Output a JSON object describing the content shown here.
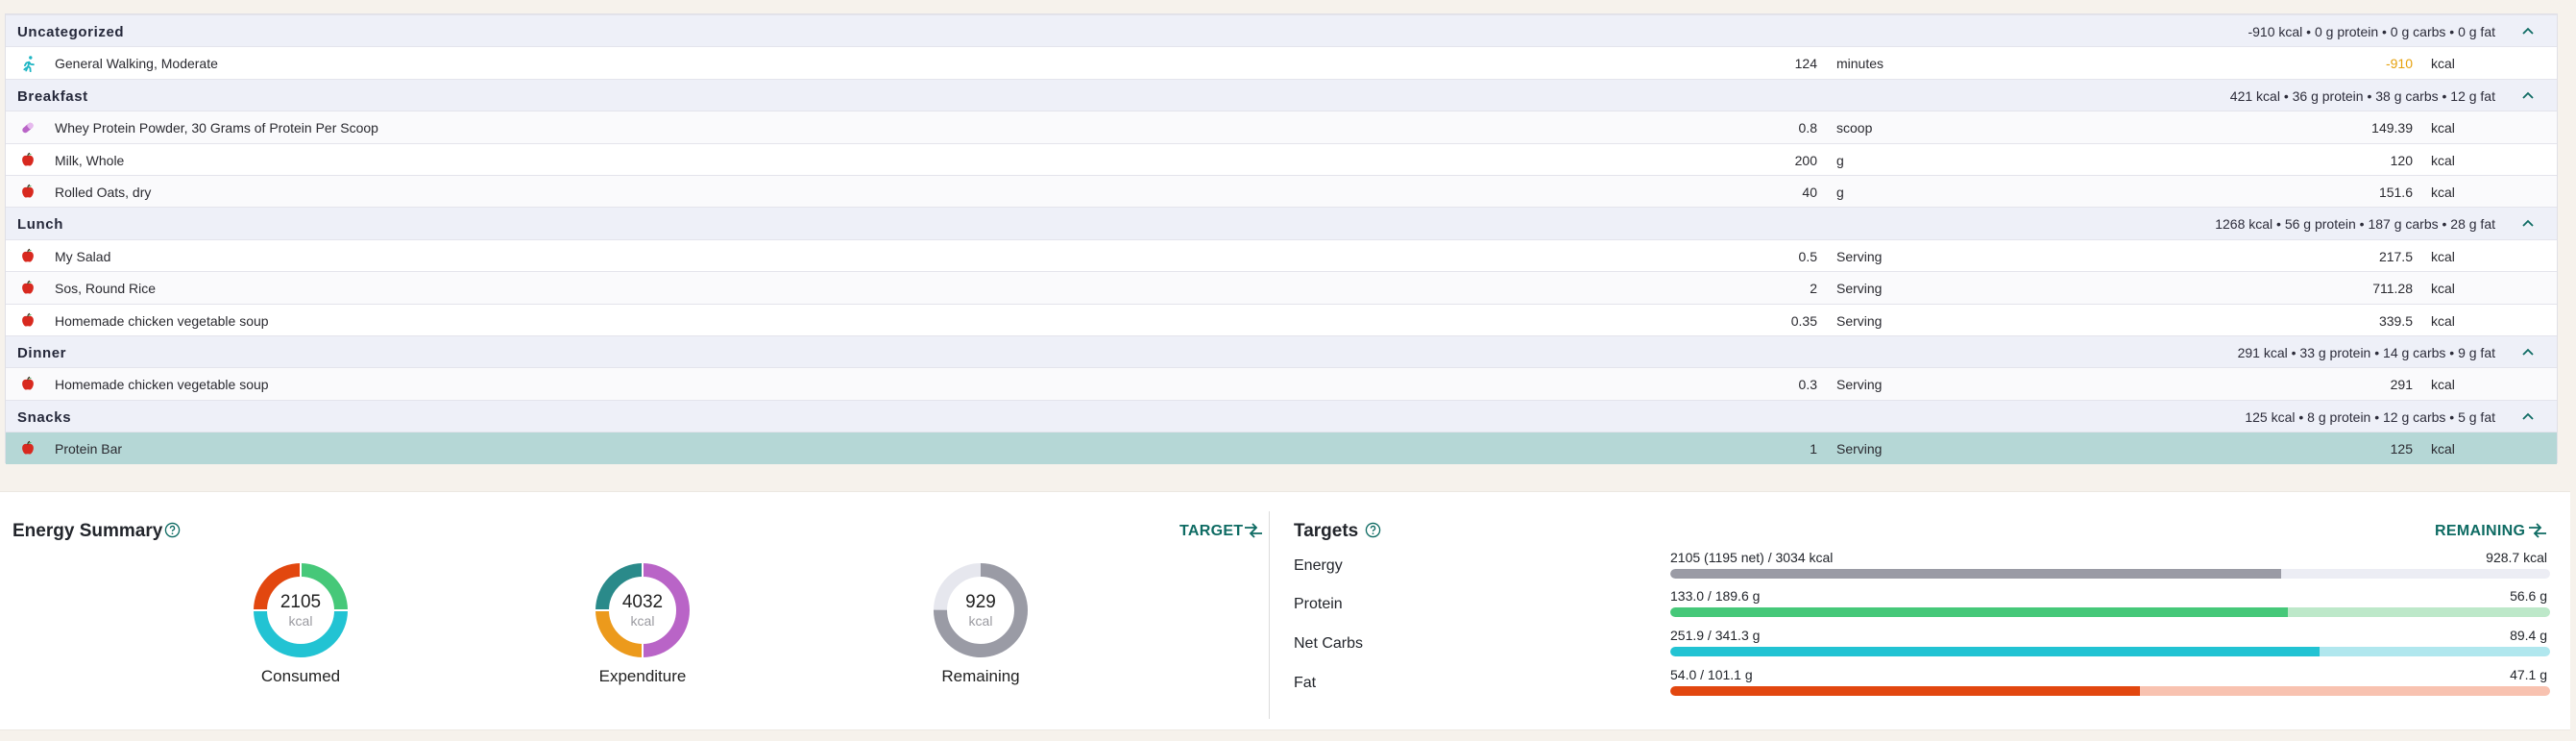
{
  "groups": [
    {
      "name": "Uncategorized",
      "summary": "-910 kcal • 0 g protein • 0 g carbs • 0 g fat",
      "items": [
        {
          "icon": "exercise-icon",
          "name": "General Walking, Moderate",
          "amount": "124",
          "unit": "minutes",
          "value": "-910",
          "value_unit": "kcal",
          "negative": true
        }
      ]
    },
    {
      "name": "Breakfast",
      "summary": "421 kcal • 36 g protein • 38 g carbs • 12 g fat",
      "items": [
        {
          "icon": "supplement-icon",
          "name": "Whey Protein Powder, 30 Grams of Protein Per Scoop",
          "amount": "0.8",
          "unit": "scoop",
          "value": "149.39",
          "value_unit": "kcal"
        },
        {
          "icon": "apple-icon",
          "name": "Milk, Whole",
          "amount": "200",
          "unit": "g",
          "value": "120",
          "value_unit": "kcal"
        },
        {
          "icon": "apple-icon",
          "name": "Rolled Oats, dry",
          "amount": "40",
          "unit": "g",
          "value": "151.6",
          "value_unit": "kcal"
        }
      ]
    },
    {
      "name": "Lunch",
      "summary": "1268 kcal • 56 g protein • 187 g carbs • 28 g fat",
      "items": [
        {
          "icon": "apple-icon",
          "name": "My Salad",
          "amount": "0.5",
          "unit": "Serving",
          "value": "217.5",
          "value_unit": "kcal"
        },
        {
          "icon": "apple-icon",
          "name": "Sos, Round Rice",
          "amount": "2",
          "unit": "Serving",
          "value": "711.28",
          "value_unit": "kcal"
        },
        {
          "icon": "apple-icon",
          "name": "Homemade chicken vegetable soup",
          "amount": "0.35",
          "unit": "Serving",
          "value": "339.5",
          "value_unit": "kcal"
        }
      ]
    },
    {
      "name": "Dinner",
      "summary": "291 kcal • 33 g protein • 14 g carbs • 9 g fat",
      "items": [
        {
          "icon": "apple-icon",
          "name": "Homemade chicken vegetable soup",
          "amount": "0.3",
          "unit": "Serving",
          "value": "291",
          "value_unit": "kcal"
        }
      ]
    },
    {
      "name": "Snacks",
      "summary": "125 kcal • 8 g protein • 12 g carbs • 5 g fat",
      "items": [
        {
          "icon": "apple-icon",
          "name": "Protein Bar",
          "amount": "1",
          "unit": "Serving",
          "value": "125",
          "value_unit": "kcal",
          "selected": true
        }
      ]
    }
  ],
  "energy_summary": {
    "title": "Energy Summary",
    "toggle_label": "TARGET",
    "donuts": [
      {
        "value": "2105",
        "unit": "kcal",
        "label": "Consumed",
        "segments": [
          {
            "color": "#f0d9d3",
            "fraction": 0.0
          },
          {
            "color": "#e2470f",
            "fraction": 0.25
          },
          {
            "color": "#46c879",
            "fraction": 0.25
          },
          {
            "color": "#22c3d3",
            "fraction": 0.5
          }
        ],
        "order": [
          "#22c3d3",
          "#e2470f",
          "#46c879"
        ]
      },
      {
        "value": "4032",
        "unit": "kcal",
        "label": "Expenditure"
      },
      {
        "value": "929",
        "unit": "kcal",
        "label": "Remaining"
      }
    ]
  },
  "targets": {
    "title": "Targets",
    "toggle_label": "REMAINING",
    "rows": [
      {
        "label": "Energy",
        "value": "2105 (1195 net) / 3034 kcal",
        "remaining": "928.7 kcal",
        "fraction": 0.694,
        "fill_color": "#9a9ba5",
        "track_color": "#ecedf4"
      },
      {
        "label": "Protein",
        "value": "133.0 / 189.6 g",
        "remaining": "56.6 g",
        "fraction": 0.702,
        "fill_color": "#46c879",
        "track_color": "#bde8c9"
      },
      {
        "label": "Net Carbs",
        "value": "251.9 / 341.3 g",
        "remaining": "89.4 g",
        "fraction": 0.738,
        "fill_color": "#22c3d3",
        "track_color": "#b0e7ee"
      },
      {
        "label": "Fat",
        "value": "54.0 / 101.1 g",
        "remaining": "47.1 g",
        "fraction": 0.534,
        "fill_color": "#e2470f",
        "track_color": "#f8c2b0"
      }
    ]
  }
}
